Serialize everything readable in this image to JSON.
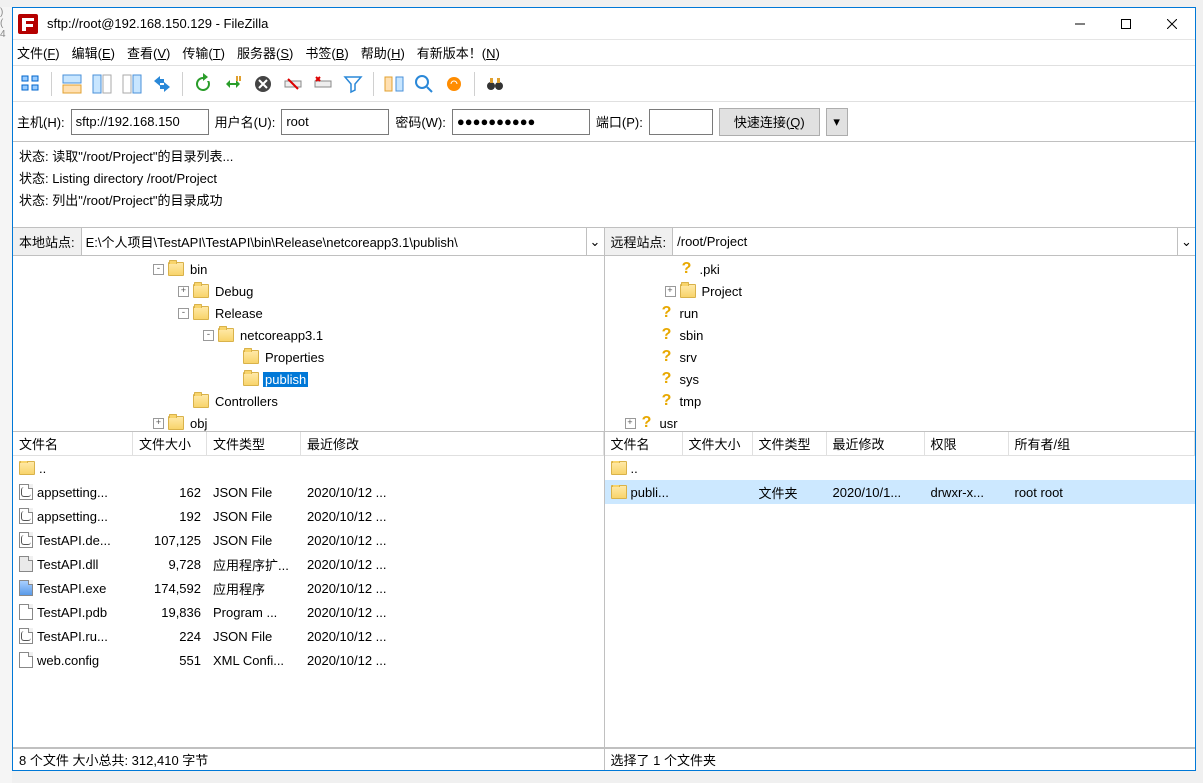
{
  "title": "sftp://root@192.168.150.129 - FileZilla",
  "menu": {
    "file": "文件(F)",
    "edit": "编辑(E)",
    "view": "查看(V)",
    "transfer": "传输(T)",
    "server": "服务器(S)",
    "bookmark": "书签(B)",
    "help": "帮助(H)",
    "newver": "有新版本！(N)"
  },
  "quickbar": {
    "host_label": "主机(H):",
    "host_value": "sftp://192.168.150",
    "user_label": "用户名(U):",
    "user_value": "root",
    "pass_label": "密码(W):",
    "pass_value": "●●●●●●●●●●",
    "port_label": "端口(P):",
    "port_value": "",
    "connect_label": "快速连接(Q)"
  },
  "log": [
    "状态: 读取\"/root/Project\"的目录列表...",
    "状态: Listing directory /root/Project",
    "状态: 列出\"/root/Project\"的目录成功"
  ],
  "local": {
    "site_label": "本地站点:",
    "path": "E:\\个人项目\\TestAPI\\TestAPI\\bin\\Release\\netcoreapp3.1\\publish\\",
    "tree": [
      {
        "indent": 140,
        "toggle": "-",
        "type": "folder",
        "label": "bin"
      },
      {
        "indent": 165,
        "toggle": "+",
        "type": "folder",
        "label": "Debug"
      },
      {
        "indent": 165,
        "toggle": "-",
        "type": "folder",
        "label": "Release"
      },
      {
        "indent": 190,
        "toggle": "-",
        "type": "folder",
        "label": "netcoreapp3.1"
      },
      {
        "indent": 215,
        "toggle": "",
        "type": "folder",
        "label": "Properties"
      },
      {
        "indent": 215,
        "toggle": "",
        "type": "folder",
        "label": "publish",
        "selected": true
      },
      {
        "indent": 165,
        "toggle": "",
        "type": "folder",
        "label": "Controllers"
      },
      {
        "indent": 140,
        "toggle": "+",
        "type": "folder",
        "label": "obj"
      }
    ],
    "cols": {
      "name": "文件名",
      "size": "文件大小",
      "type": "文件类型",
      "mod": "最近修改"
    },
    "files": [
      {
        "icon": "folder",
        "name": "..",
        "size": "",
        "type": "",
        "mod": ""
      },
      {
        "icon": "json",
        "name": "appsetting...",
        "size": "162",
        "type": "JSON File",
        "mod": "2020/10/12 ..."
      },
      {
        "icon": "json",
        "name": "appsetting...",
        "size": "192",
        "type": "JSON File",
        "mod": "2020/10/12 ..."
      },
      {
        "icon": "json",
        "name": "TestAPI.de...",
        "size": "107,125",
        "type": "JSON File",
        "mod": "2020/10/12 ..."
      },
      {
        "icon": "dll",
        "name": "TestAPI.dll",
        "size": "9,728",
        "type": "应用程序扩...",
        "mod": "2020/10/12 ..."
      },
      {
        "icon": "exe",
        "name": "TestAPI.exe",
        "size": "174,592",
        "type": "应用程序",
        "mod": "2020/10/12 ..."
      },
      {
        "icon": "file",
        "name": "TestAPI.pdb",
        "size": "19,836",
        "type": "Program ...",
        "mod": "2020/10/12 ..."
      },
      {
        "icon": "json",
        "name": "TestAPI.ru...",
        "size": "224",
        "type": "JSON File",
        "mod": "2020/10/12 ..."
      },
      {
        "icon": "file",
        "name": "web.config",
        "size": "551",
        "type": "XML Confi...",
        "mod": "2020/10/12 ..."
      }
    ],
    "status": "8 个文件  大小总共: 312,410 字节"
  },
  "remote": {
    "site_label": "远程站点:",
    "path": "/root/Project",
    "tree": [
      {
        "indent": 60,
        "toggle": "",
        "type": "unk",
        "label": ".pki"
      },
      {
        "indent": 60,
        "toggle": "+",
        "type": "folder",
        "label": "Project"
      },
      {
        "indent": 40,
        "toggle": "",
        "type": "unk",
        "label": "run"
      },
      {
        "indent": 40,
        "toggle": "",
        "type": "unk",
        "label": "sbin"
      },
      {
        "indent": 40,
        "toggle": "",
        "type": "unk",
        "label": "srv"
      },
      {
        "indent": 40,
        "toggle": "",
        "type": "unk",
        "label": "sys"
      },
      {
        "indent": 40,
        "toggle": "",
        "type": "unk",
        "label": "tmp"
      },
      {
        "indent": 20,
        "toggle": "+",
        "type": "unk",
        "label": "usr"
      }
    ],
    "cols": {
      "name": "文件名",
      "size": "文件大小",
      "type": "文件类型",
      "mod": "最近修改",
      "perm": "权限",
      "owner": "所有者/组"
    },
    "files": [
      {
        "icon": "folder",
        "name": "..",
        "size": "",
        "type": "",
        "mod": "",
        "perm": "",
        "owner": ""
      },
      {
        "icon": "folder",
        "name": "publi...",
        "size": "",
        "type": "文件夹",
        "mod": "2020/10/1...",
        "perm": "drwxr-x...",
        "owner": "root root",
        "sel": true
      }
    ],
    "status": "选择了 1 个文件夹"
  }
}
